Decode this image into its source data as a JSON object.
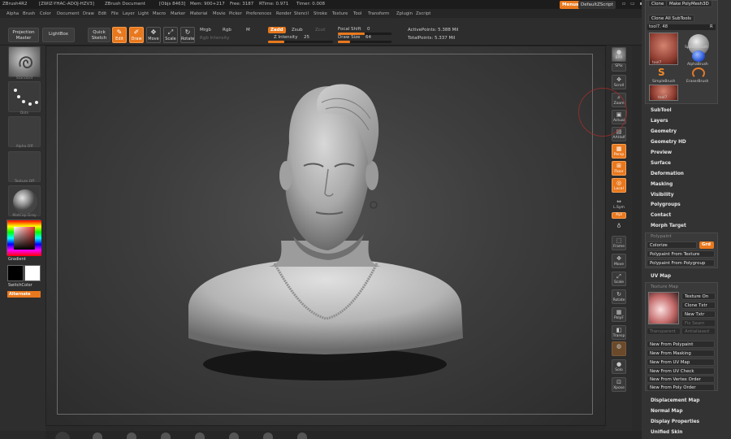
{
  "title_bar": {
    "app": "ZBrush4R2",
    "build": "[ZWIZ-YHAC-ADOJ-HZV3]",
    "document": "ZBrush Document",
    "objs": "[Objs 8463]",
    "mem": "Mem: 900+217",
    "free": "Free: 3187",
    "rtime": "RTime: 0.971",
    "timer": "Timer: 0.008",
    "menus_button": "Menus",
    "default_script": "DefaultZScript"
  },
  "menu_bar": [
    "Alpha",
    "Brush",
    "Color",
    "Document",
    "Draw",
    "Edit",
    "File",
    "Layer",
    "Light",
    "Macro",
    "Marker",
    "Material",
    "Movie",
    "Picker",
    "Preferences",
    "Render",
    "Stencil",
    "Stroke",
    "Texture",
    "Tool",
    "Transform",
    "Zplugin",
    "Zscript"
  ],
  "shelf": {
    "projection_master": "Projection Master",
    "lightbox": "LightBox",
    "quick_sketch": "Quick Sketch",
    "edit": "Edit",
    "draw": "Draw",
    "move": "Move",
    "scale": "Scale",
    "rotate": "Rotate",
    "mrgb": "Mrgb",
    "rgb": "Rgb",
    "m": "M",
    "rgb_intensity": "Rgb Intensity",
    "zadd": "Zadd",
    "zsub": "Zsub",
    "zcut": "Zcut",
    "z_intensity_label": "Z Intensity",
    "z_intensity": "25",
    "z_intensity_fill": 0.25,
    "focal_shift_label": "Focal Shift",
    "focal_shift": "0",
    "draw_size_label": "Draw Size",
    "draw_size": "64",
    "active_points": "ActivePoints: 5.388 Mil",
    "total_points": "TotalPoints: 5.337 Mil"
  },
  "left_shelf": {
    "brush": "Standard",
    "stroke": "Dots",
    "alpha": "Alpha Off",
    "texture": "Texture Off",
    "material": "MatCap Gray",
    "gradient": "Gradient",
    "switch_color": "SwitchColor",
    "alternate": "Alternate"
  },
  "right_strip": [
    "BPR",
    "SPix",
    "Scroll",
    "Zoom",
    "Actual",
    "AAHalf",
    "Persp",
    "Floor",
    "Local",
    "L.Sym",
    "Xyz",
    "Frame",
    "Move",
    "Scale",
    "Rotate",
    "PolyF",
    "Transp",
    "Ghost",
    "Solo",
    "Xpose"
  ],
  "tool_palette": {
    "top_buttons": [
      "Clone",
      "Make PolyMesh3D"
    ],
    "clone_subtools": "Clone All SubTools",
    "tool_name": "tool7. 48",
    "tool_r": "R",
    "thumbs": [
      "tool7",
      "SphereBrush",
      "AlphaBrush",
      "SimpleBrush",
      "EraserBrush",
      "tool7"
    ],
    "sections": [
      "SubTool",
      "Layers",
      "Geometry",
      "Geometry HD",
      "Preview",
      "Surface",
      "Deformation",
      "Masking",
      "Visibility",
      "Polygroups",
      "Contact",
      "Morph Target"
    ],
    "polypaint_header": "Polypaint",
    "colorize": "Colorize",
    "grd": "Grd",
    "polypaint_from_texture": "Polypaint From Texture",
    "polypaint_from_polygroup": "Polypaint From Polygroup",
    "uv_map": "UV Map",
    "texture_map_header": "Texture Map",
    "texture_on": "Texture On",
    "clone_txtr": "Clone Txtr",
    "new_txtr": "New Txtr",
    "fix_seam": "Fix Seam",
    "transparent": "Transparent",
    "antialiased": "Antialiased",
    "new_from": [
      "New From Polypaint",
      "New From Masking",
      "New From UV Map",
      "New From UV Check",
      "New From Vertex Order",
      "New From Poly Order"
    ],
    "bottom_sections": [
      "Displacement Map",
      "Normal Map",
      "Display Properties",
      "Unified Skin"
    ]
  },
  "colors": {
    "accent": "#e8781e",
    "panel": "#333333",
    "canvas": "#3d3d3d"
  }
}
